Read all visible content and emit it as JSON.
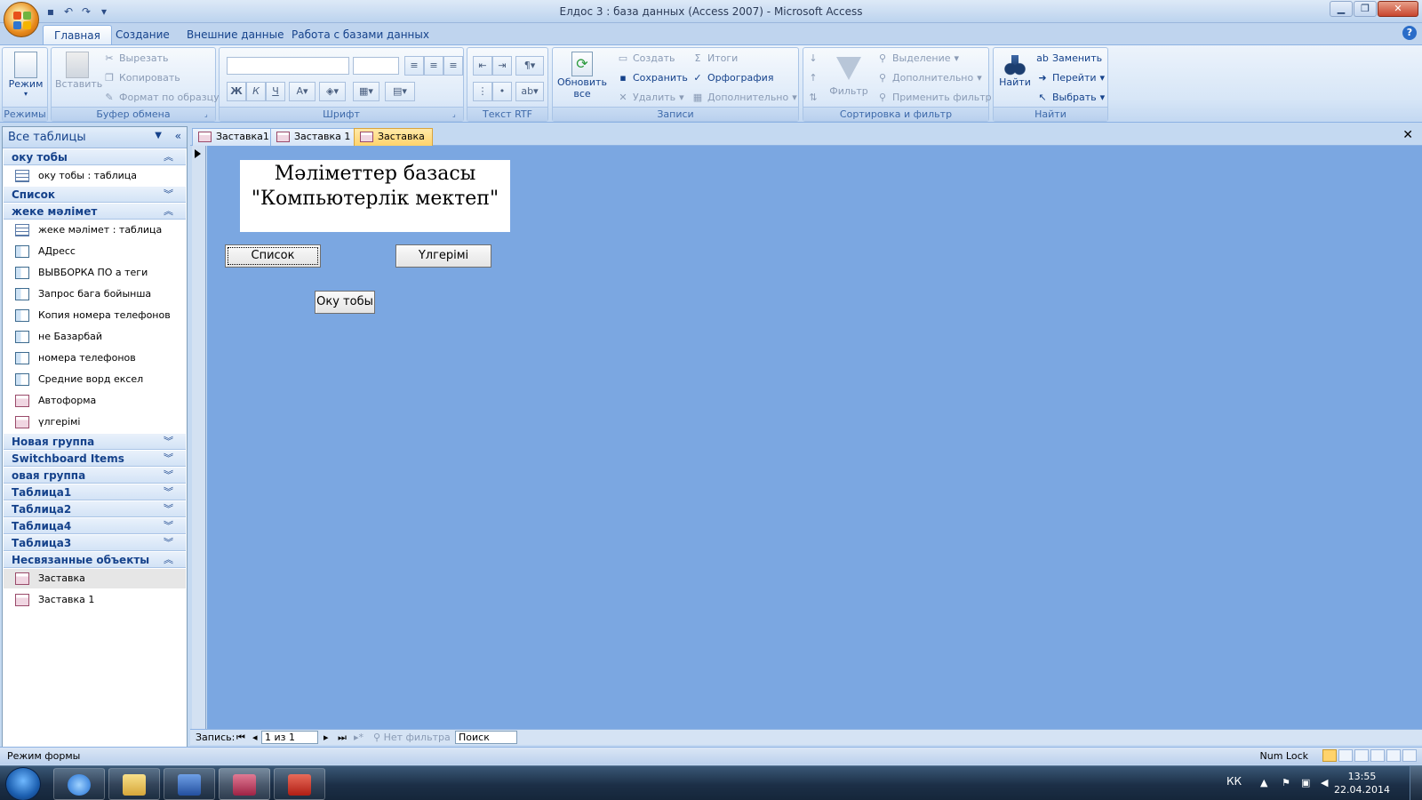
{
  "window": {
    "title": "Елдос 3 : база данных (Access 2007)  -  Microsoft Access"
  },
  "ribbon_tabs": [
    "Главная",
    "Создание",
    "Внешние данные",
    "Работа с базами данных"
  ],
  "ribbon": {
    "modes": {
      "title": "Режимы",
      "view_label": "Режим"
    },
    "clipboard": {
      "title": "Буфер обмена",
      "paste": "Вставить",
      "cut": "Вырезать",
      "copy": "Копировать",
      "format_painter": "Формат по образцу"
    },
    "font": {
      "title": "Шрифт",
      "bold": "Ж",
      "italic": "К",
      "underline": "Ч"
    },
    "rtf": {
      "title": "Текст RTF"
    },
    "records": {
      "title": "Записи",
      "refresh": "Обновить",
      "refresh2": "все",
      "new": "Создать",
      "save": "Сохранить",
      "delete": "Удалить",
      "totals": "Итоги",
      "spelling": "Орфография",
      "more": "Дополнительно"
    },
    "sort_filter": {
      "title": "Сортировка и фильтр",
      "filter": "Фильтр",
      "selection": "Выделение",
      "advanced": "Дополнительно",
      "apply": "Применить фильтр"
    },
    "find": {
      "title": "Найти",
      "find": "Найти",
      "replace": "Заменить",
      "goto": "Перейти",
      "select": "Выбрать"
    }
  },
  "nav_pane": {
    "header": "Все таблицы",
    "groups": [
      {
        "label": "оку тобы",
        "expanded": true,
        "items": [
          "оку тобы : таблица"
        ]
      },
      {
        "label": "Список",
        "expanded": false,
        "items": []
      },
      {
        "label": "жеке мәлімет",
        "expanded": true,
        "items": [
          "жеке мәлімет : таблица",
          "АДресс",
          "ВЫВБОРКА  ПО а теги",
          "Запрос бага бойынша",
          "Копия номера телефонов",
          "не Базарбай",
          "номера телефонов",
          "Средние ворд ексел",
          "Автоформа",
          "үлгерімі"
        ]
      },
      {
        "label": "Новая группа",
        "expanded": false,
        "items": []
      },
      {
        "label": "Switchboard Items",
        "expanded": false,
        "items": []
      },
      {
        "label": "овая группа",
        "expanded": false,
        "items": []
      },
      {
        "label": "Таблица1",
        "expanded": false,
        "items": []
      },
      {
        "label": "Таблица2",
        "expanded": false,
        "items": []
      },
      {
        "label": "Таблица4",
        "expanded": false,
        "items": []
      },
      {
        "label": "Таблица3",
        "expanded": false,
        "items": []
      },
      {
        "label": "Несвязанные объекты",
        "expanded": true,
        "items": [
          "Заставка",
          "Заставка 1"
        ]
      }
    ]
  },
  "doc_tabs": [
    "Заставка1",
    "Заставка 1",
    "Заставка"
  ],
  "form": {
    "title_line1": "Мәліметтер базасы",
    "title_line2": "\"Компьютерлік мектеп\"",
    "btn_list": "Список",
    "btn_grades": "Үлгерімі",
    "btn_group": "Оку тобы"
  },
  "record_nav": {
    "label": "Запись:",
    "position": "1 из 1",
    "filter": "Нет фильтра",
    "search": "Поиск"
  },
  "status": {
    "mode": "Режим формы",
    "numlock": "Num Lock"
  },
  "taskbar": {
    "lang": "КК",
    "time": "13:55",
    "date": "22.04.2014"
  },
  "colors": {
    "form_bg": "#7ba7e1",
    "ribbon_bg": "#d7e6f7",
    "active_tab": "#ffd36b"
  }
}
